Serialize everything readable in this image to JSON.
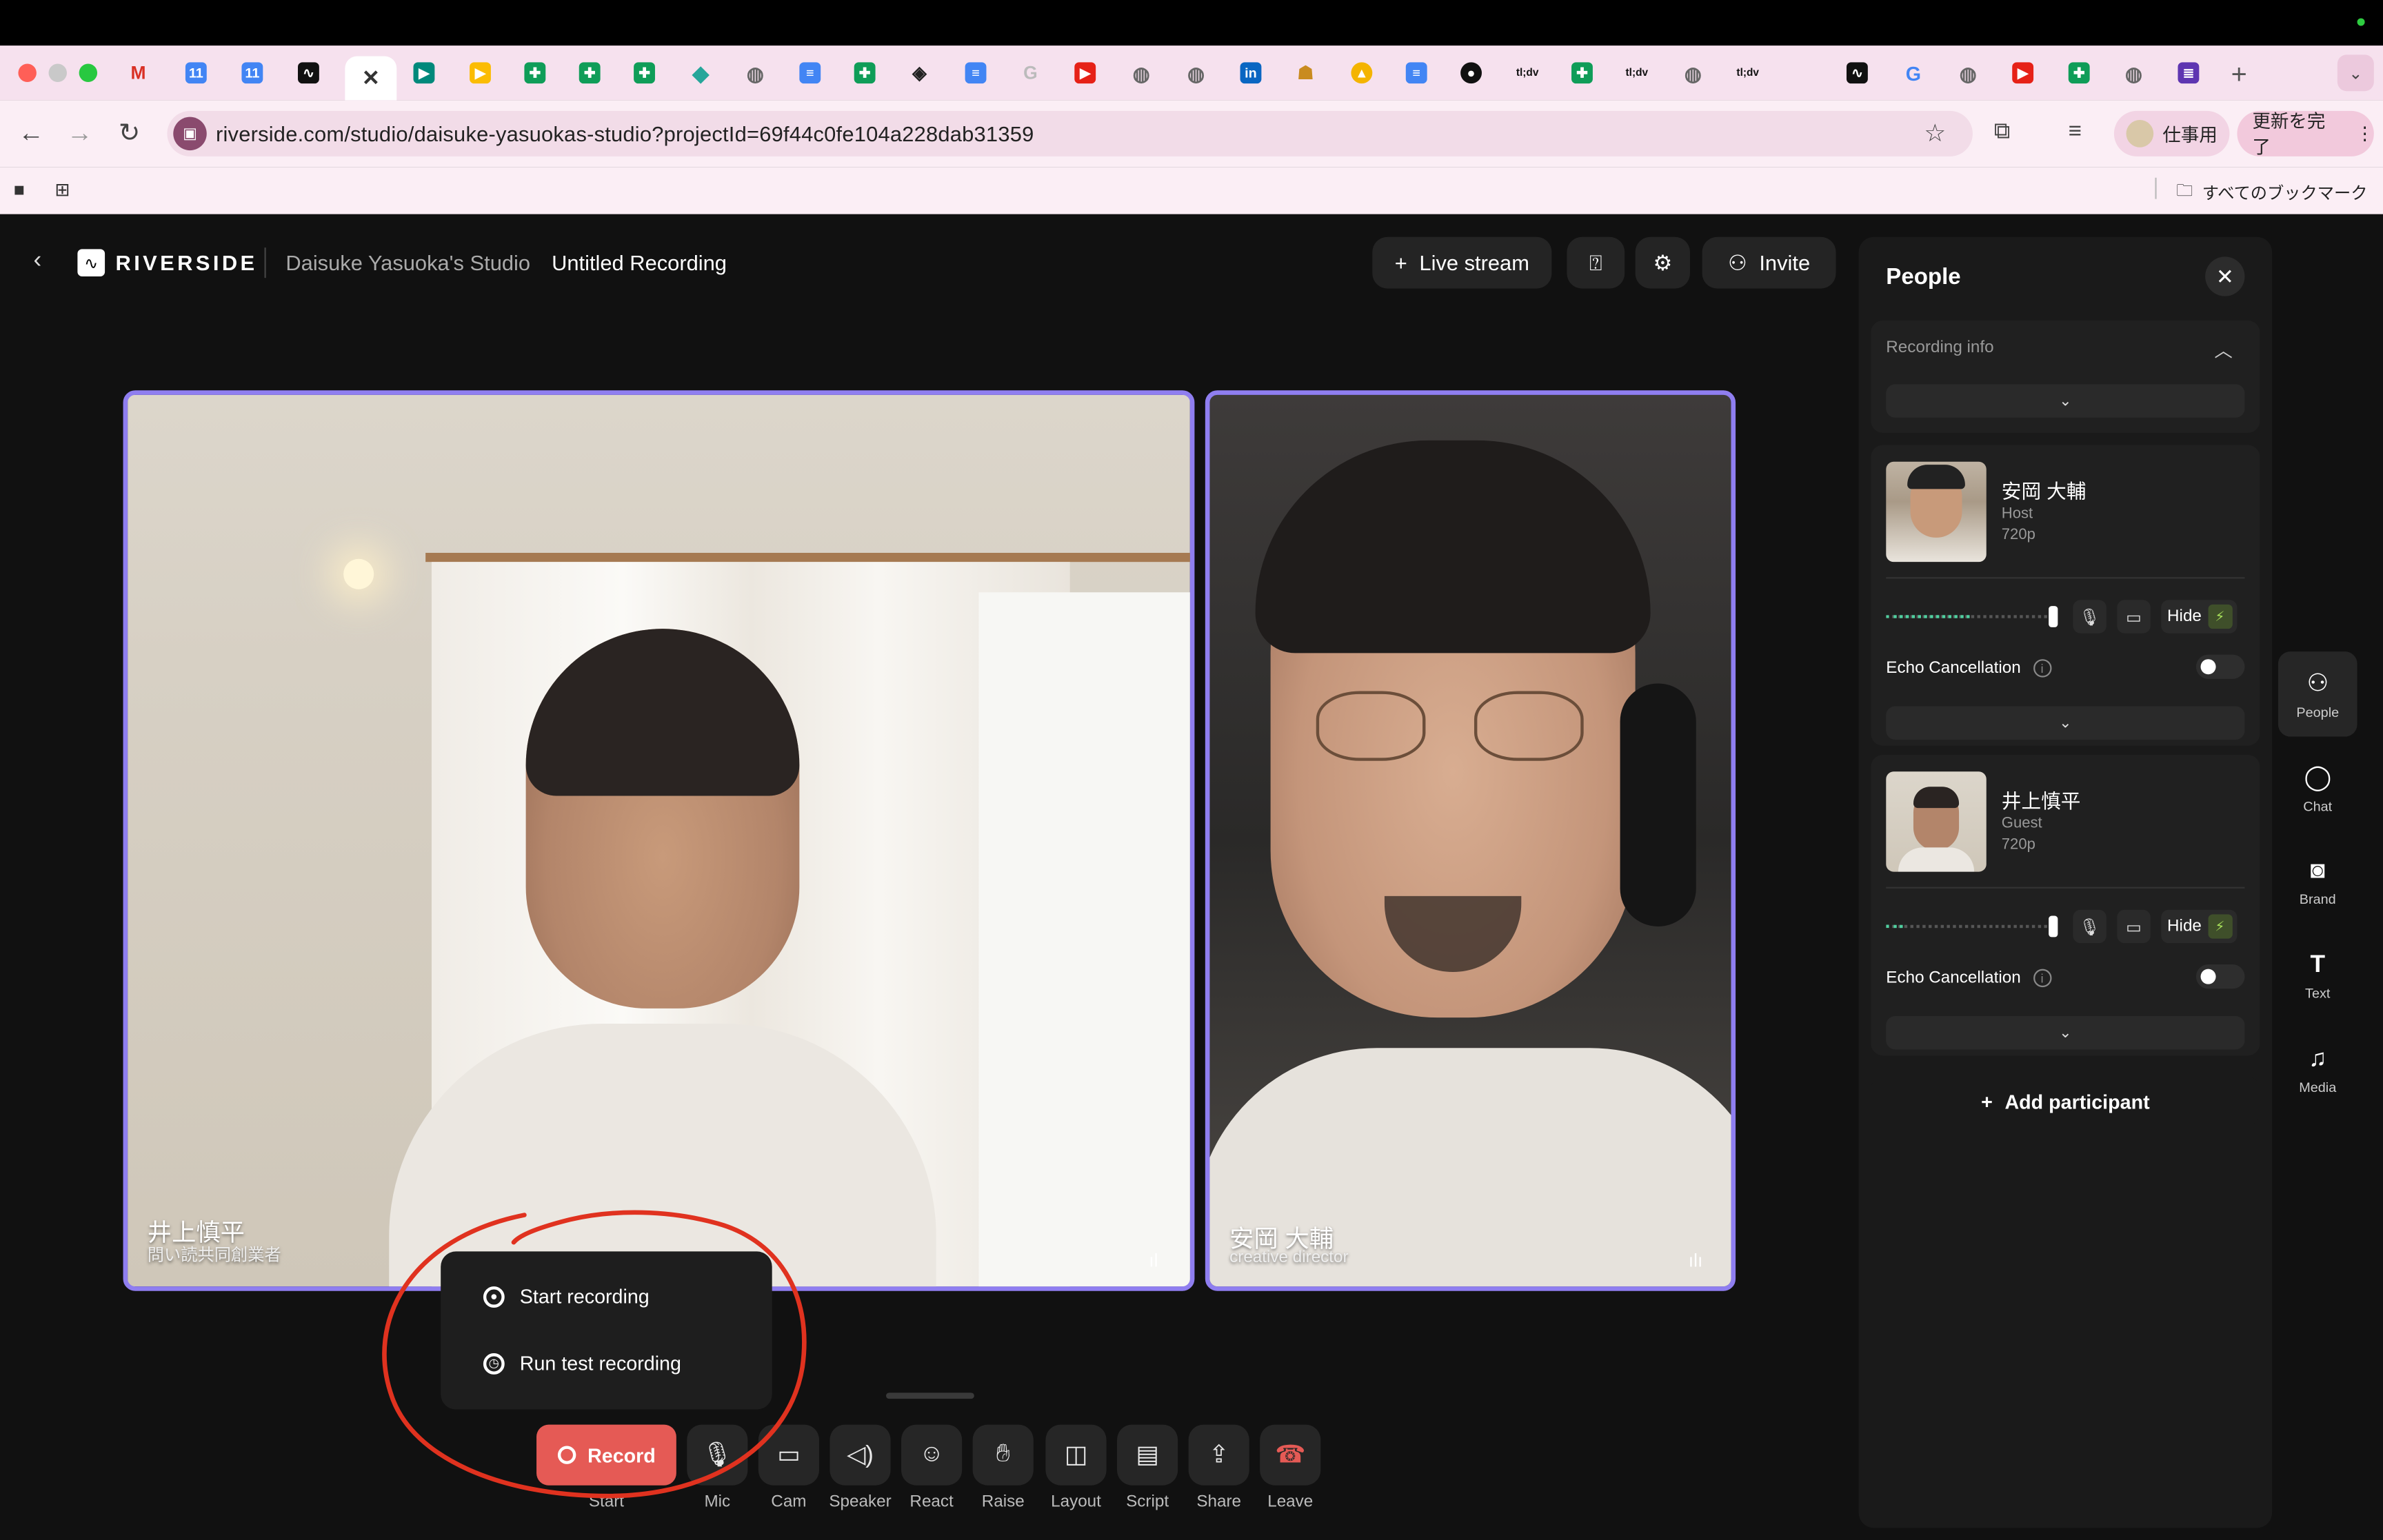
{
  "browser": {
    "url": "riverside.com/studio/daisuke-yasuokas-studio?projectId=69f44c0fe104a228dab31359",
    "profile_label": "仕事用",
    "update_label": "更新を完了",
    "bookmarks_all": "すべてのブックマーク",
    "tab_texts": [
      "tl;dv",
      "tl;dv",
      "tl;dv"
    ]
  },
  "header": {
    "brand": "RIVERSIDE",
    "studio_name": "Daisuke Yasuoka's Studio",
    "recording_title": "Untitled Recording",
    "live_stream_label": "Live stream",
    "invite_label": "Invite"
  },
  "videos": [
    {
      "name": "井上慎平",
      "subtitle": "問い読共同創業者"
    },
    {
      "name": "安岡 大輔",
      "subtitle": "creative director"
    }
  ],
  "record_menu": {
    "start_recording": "Start recording",
    "run_test_recording": "Run test recording"
  },
  "toolbar": {
    "record_label": "Record",
    "record_caption": "Start",
    "items": [
      {
        "label": "Mic",
        "icon": "mic-icon"
      },
      {
        "label": "Cam",
        "icon": "camera-icon"
      },
      {
        "label": "Speaker",
        "icon": "speaker-icon"
      },
      {
        "label": "React",
        "icon": "react-icon"
      },
      {
        "label": "Raise",
        "icon": "raise-hand-icon"
      },
      {
        "label": "Layout",
        "icon": "layout-icon"
      },
      {
        "label": "Script",
        "icon": "script-icon"
      },
      {
        "label": "Share",
        "icon": "share-icon"
      },
      {
        "label": "Leave",
        "icon": "leave-icon"
      }
    ]
  },
  "people_panel": {
    "title": "People",
    "recording_info_label": "Recording info",
    "participants": [
      {
        "name": "安岡 大輔",
        "role": "Host",
        "resolution": "720p",
        "level": 0.5,
        "hide_label": "Hide",
        "echo_label": "Echo Cancellation",
        "echo_on": false
      },
      {
        "name": "井上慎平",
        "role": "Guest",
        "resolution": "720p",
        "level": 0.1,
        "hide_label": "Hide",
        "echo_label": "Echo Cancellation",
        "echo_on": false
      }
    ],
    "add_participant_label": "Add participant"
  },
  "rail": [
    {
      "label": "People",
      "icon": "people-icon",
      "active": true
    },
    {
      "label": "Chat",
      "icon": "chat-icon",
      "active": false
    },
    {
      "label": "Brand",
      "icon": "brand-icon",
      "active": false
    },
    {
      "label": "Text",
      "icon": "text-icon",
      "active": false
    },
    {
      "label": "Media",
      "icon": "media-icon",
      "active": false
    }
  ],
  "colors": {
    "tile_border": "#8f7ef0",
    "record_red": "#e55a55",
    "annotation_red": "#e0321f",
    "level_green": "#4fd1a0"
  }
}
